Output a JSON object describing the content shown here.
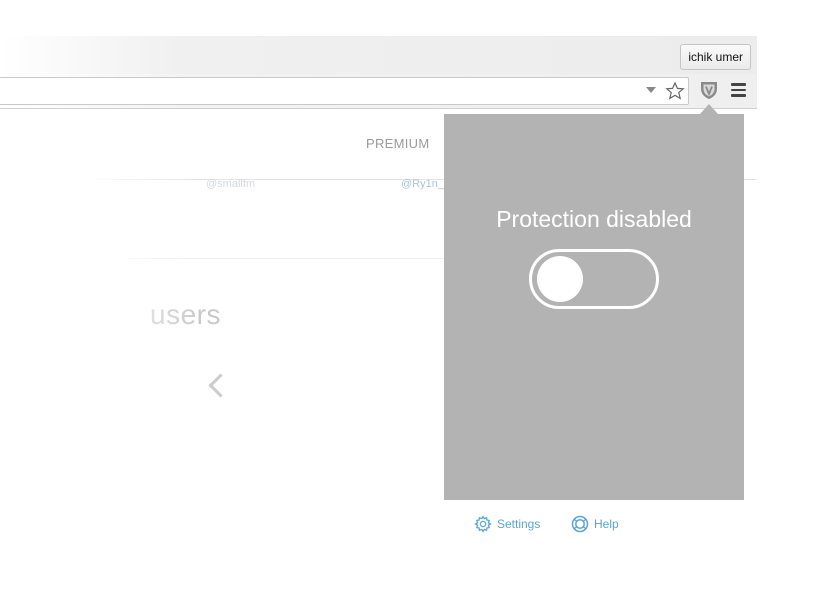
{
  "browser": {
    "profile_name": "ichik umer",
    "icons": [
      "chevron-down-icon",
      "star-icon",
      "shield-icon",
      "hamburger-menu-icon"
    ]
  },
  "site": {
    "nav_premium": "PREMIUM",
    "handle_1": "@smallfm",
    "handle_2": "@Ry1n_",
    "heading_fragment": "users"
  },
  "popup": {
    "title": "Protection disabled",
    "toggle_state": "off",
    "settings_label": "Settings",
    "help_label": "Help",
    "background_color": "#b3b3b3",
    "link_color": "#5aa5d4"
  }
}
